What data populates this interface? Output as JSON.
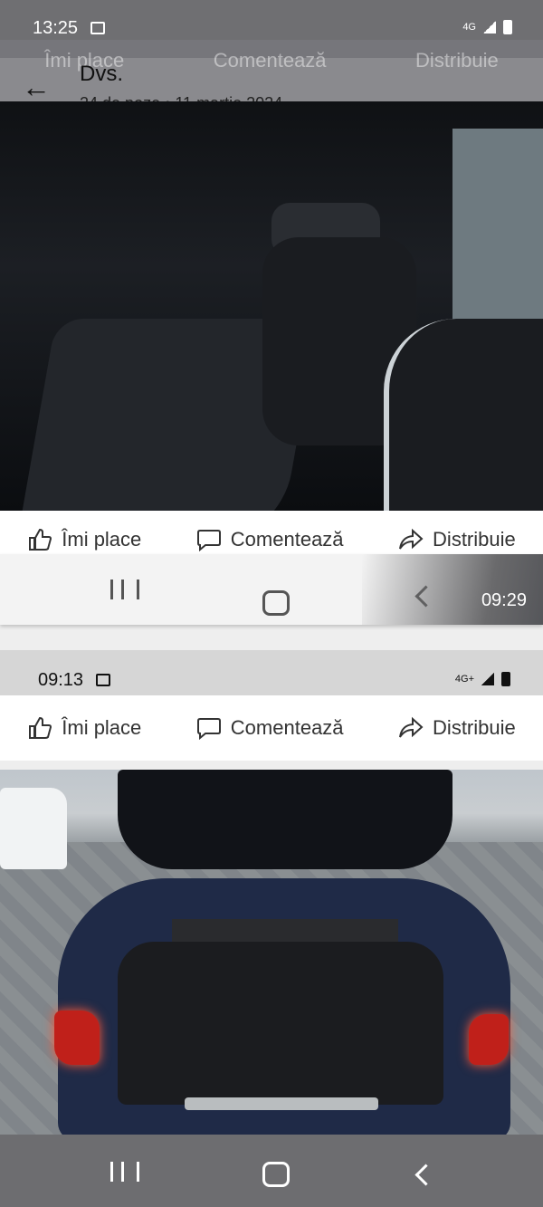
{
  "status_bar_top": {
    "time": "13:25",
    "network": "4G"
  },
  "header": {
    "back_icon": "arrow-left-icon",
    "title": "Dvs.",
    "subtitle": "24 de poze  •  11 martie 2024"
  },
  "actions": {
    "like_label": "Îmi place",
    "comment_label": "Comentează",
    "share_label": "Distribuie"
  },
  "nav_bar_middle": {
    "clock_badge": "09:29"
  },
  "status_bar_second": {
    "time": "09:13",
    "network": "4G+"
  },
  "colors": {
    "status_bar": "#6f6f72",
    "action_bar": "#ffffff",
    "car_body": "#1f2a47"
  }
}
